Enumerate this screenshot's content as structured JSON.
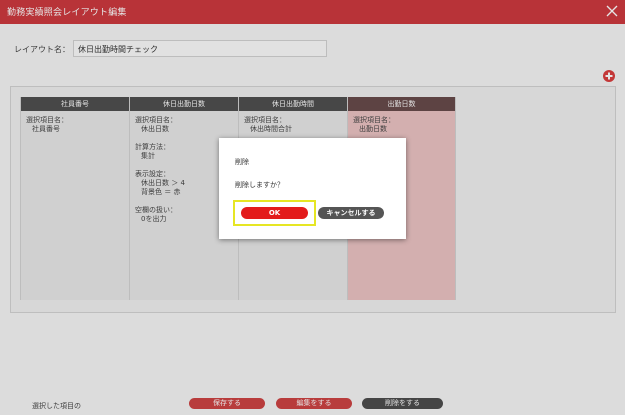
{
  "window": {
    "title": "勤務実績照会レイアウト編集"
  },
  "form": {
    "name_label": "レイアウト名：",
    "name_value": "休日出勤時間チェック"
  },
  "columns": [
    {
      "header": "社員番号",
      "lines": [
        {
          "label": "選択項目名：",
          "value": "社員番号"
        }
      ]
    },
    {
      "header": "休日出勤日数",
      "lines": [
        {
          "label": "選択項目名：",
          "value": "休出日数"
        },
        {
          "label": "計算方法：",
          "value": "集計"
        },
        {
          "label": "表示設定：",
          "value": "休出日数 ＞ 4"
        },
        {
          "label": "",
          "value": "背景色 ＝ 赤"
        },
        {
          "label": "空欄の扱い：",
          "value": "0を出力"
        }
      ]
    },
    {
      "header": "休日出勤時間",
      "lines": [
        {
          "label": "選択項目名：",
          "value": "休出時間合計"
        }
      ]
    },
    {
      "header": "出勤日数",
      "lines": [
        {
          "label": "選択項目名：",
          "value": "出勤日数"
        }
      ]
    }
  ],
  "dialog": {
    "title": "削除",
    "message": "削除しますか？",
    "ok_label": "OK",
    "cancel_label": "キャンセルする"
  },
  "footer": {
    "selected_label": "選択した項目の",
    "save_label": "保存する",
    "edit_label": "編集をする",
    "delete_label": "削除をする"
  },
  "colors": {
    "brand_red": "#c8272d",
    "selected_column": "#eabebe",
    "highlight": "#e6e624"
  }
}
